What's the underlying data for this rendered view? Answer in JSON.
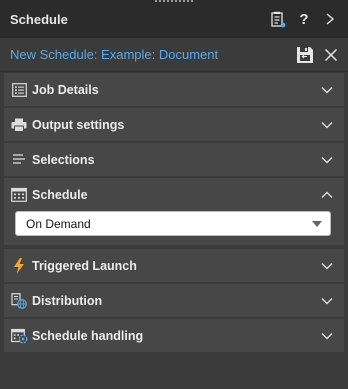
{
  "header": {
    "title": "Schedule",
    "help_label": "?"
  },
  "subheader": {
    "title": "New Schedule: Example: Document"
  },
  "sections": [
    {
      "label": "Job Details",
      "icon": "list-icon",
      "expanded": false
    },
    {
      "label": "Output settings",
      "icon": "printer-icon",
      "expanded": false
    },
    {
      "label": "Selections",
      "icon": "selections-icon",
      "expanded": false
    },
    {
      "label": "Schedule",
      "icon": "calendar-icon",
      "expanded": true
    },
    {
      "label": "Triggered Launch",
      "icon": "lightning-icon",
      "expanded": false
    },
    {
      "label": "Distribution",
      "icon": "distribution-icon",
      "expanded": false
    },
    {
      "label": "Schedule handling",
      "icon": "schedule-settings-icon",
      "expanded": false
    }
  ],
  "schedule": {
    "selected_option": "On Demand"
  },
  "colors": {
    "accent": "#5aa9e6",
    "lightning": "#f0a830",
    "header_bg": "#2b2b2b",
    "section_bg": "#474747"
  }
}
